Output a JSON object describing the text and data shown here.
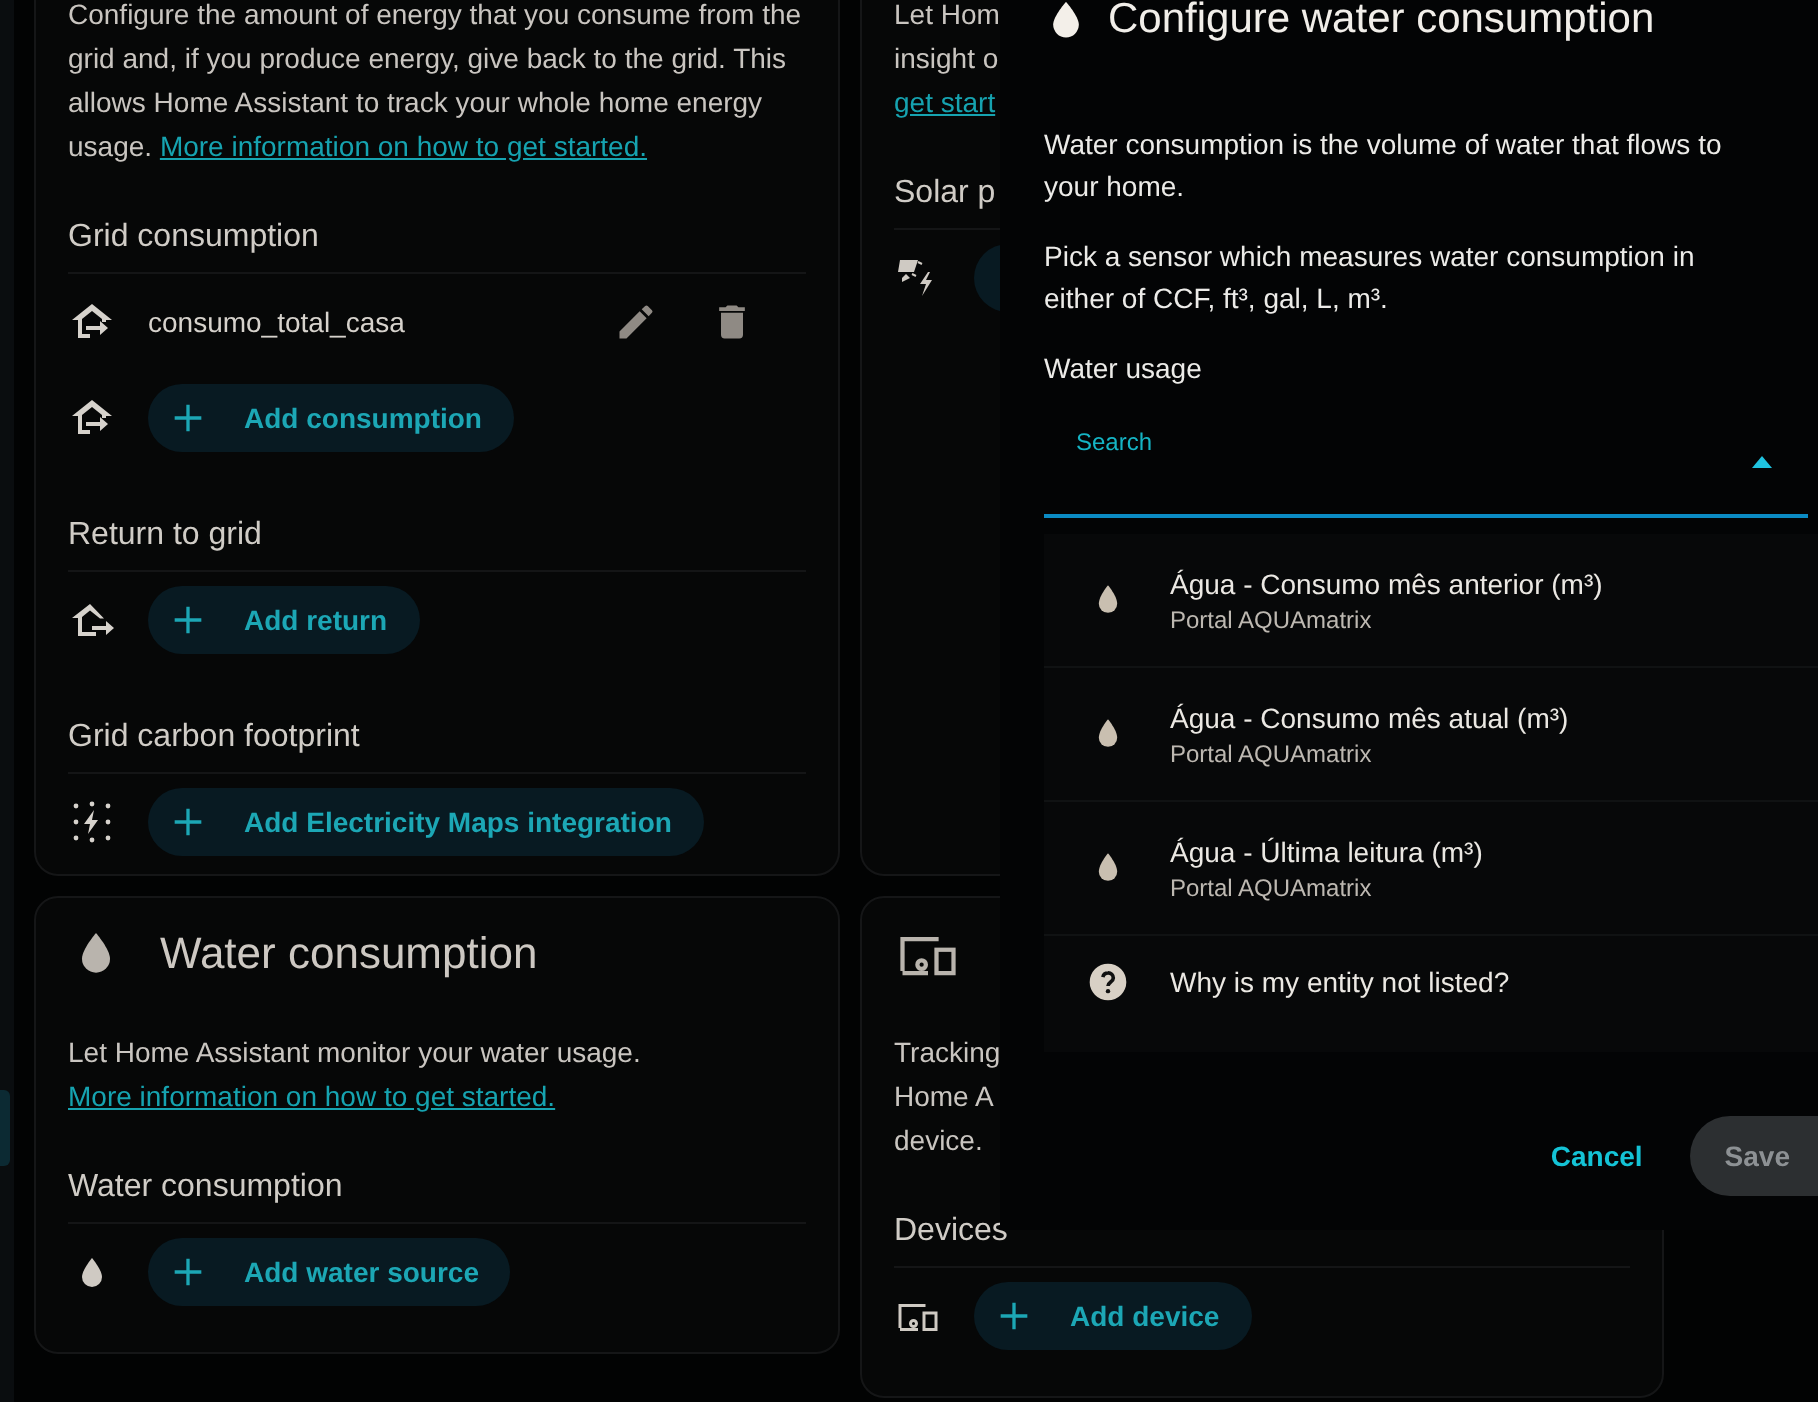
{
  "grid_card": {
    "description": "Configure the amount of energy that you consume from the grid and, if you produce energy, give back to the grid. This allows Home Assistant to track your whole home energy usage.",
    "link": "More information on how to get started.",
    "sections": [
      {
        "title": "Grid consumption",
        "kind": "import",
        "entries": [
          {
            "name": "consumo_total_casa"
          }
        ],
        "add_label": "Add consumption"
      },
      {
        "title": "Return to grid",
        "kind": "export",
        "add_label": "Add return"
      },
      {
        "title": "Grid carbon footprint",
        "kind": "carbon",
        "add_label": "Add Electricity Maps integration"
      }
    ]
  },
  "water_card": {
    "title": "Water consumption",
    "description": "Let Home Assistant monitor your water usage.",
    "link": "More information on how to get started.",
    "sections": [
      {
        "title": "Water consumption",
        "kind": "water",
        "add_label": "Add water source"
      }
    ]
  },
  "solar_card": {
    "description_lines": [
      "Let Hom",
      "insight o"
    ],
    "link": "get start",
    "sections": [
      {
        "title": "Solar p",
        "kind": "solar"
      }
    ]
  },
  "devices_card": {
    "description_lines": [
      "Tracking",
      "Home A",
      "device."
    ],
    "sections": [
      {
        "title": "Devices",
        "kind": "devices",
        "add_label": "Add device"
      }
    ]
  },
  "dialog": {
    "title": "Configure water consumption",
    "paragraphs": [
      "Water consumption is the volume of water that flows to your home.",
      "Pick a sensor which measures water consumption in either of CCF, ft³, gal, L, m³."
    ],
    "field_label": "Water usage",
    "search": {
      "label": "Search",
      "expanded": true
    },
    "options": [
      {
        "kind": "entity",
        "name": "Água - Consumo mês anterior (m³)",
        "source": "Portal AQUAmatrix"
      },
      {
        "kind": "entity",
        "name": "Água - Consumo mês atual (m³)",
        "source": "Portal AQUAmatrix"
      },
      {
        "kind": "entity",
        "name": "Água - Última leitura (m³)",
        "source": "Portal AQUAmatrix"
      },
      {
        "kind": "help",
        "name": "Why is my entity not listed?"
      }
    ],
    "buttons": [
      {
        "label": "Cancel",
        "kind": "text"
      },
      {
        "label": "Save",
        "kind": "filled"
      }
    ]
  }
}
